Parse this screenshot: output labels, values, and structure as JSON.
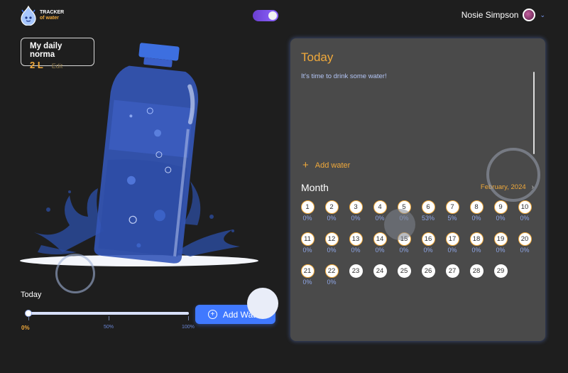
{
  "header": {
    "logo_line1": "TRACKER",
    "logo_line2": "of water",
    "user_name": "Nosie Simpson",
    "theme_toggle_on": true
  },
  "norma": {
    "title": "My daily norma",
    "value": "2 L",
    "edit_label": "Edit"
  },
  "today_progress": {
    "label": "Today",
    "fraction": 0.0,
    "ticks": [
      "0%",
      "50%",
      "100%"
    ]
  },
  "add_water_button": "Add Water",
  "panel": {
    "today_title": "Today",
    "message": "It's time to drink some water!",
    "add_water_link": "Add water",
    "month_title": "Month",
    "month_label": "February, 2024",
    "next_icon": "chevron-right-icon"
  },
  "calendar": [
    {
      "day": "1",
      "pct": "0%"
    },
    {
      "day": "2",
      "pct": "0%"
    },
    {
      "day": "3",
      "pct": "0%"
    },
    {
      "day": "4",
      "pct": "0%"
    },
    {
      "day": "5",
      "pct": "0%"
    },
    {
      "day": "6",
      "pct": "53%"
    },
    {
      "day": "7",
      "pct": "5%"
    },
    {
      "day": "8",
      "pct": "0%"
    },
    {
      "day": "9",
      "pct": "0%"
    },
    {
      "day": "10",
      "pct": "0%"
    },
    {
      "day": "11",
      "pct": "0%"
    },
    {
      "day": "12",
      "pct": "0%"
    },
    {
      "day": "13",
      "pct": "0%"
    },
    {
      "day": "14",
      "pct": "0%"
    },
    {
      "day": "15",
      "pct": "0%"
    },
    {
      "day": "16",
      "pct": "0%"
    },
    {
      "day": "17",
      "pct": "0%"
    },
    {
      "day": "18",
      "pct": "0%"
    },
    {
      "day": "19",
      "pct": "0%"
    },
    {
      "day": "20",
      "pct": "0%"
    },
    {
      "day": "21",
      "pct": "0%"
    },
    {
      "day": "22",
      "pct": "0%"
    },
    {
      "day": "23",
      "pct": ""
    },
    {
      "day": "24",
      "pct": ""
    },
    {
      "day": "25",
      "pct": ""
    },
    {
      "day": "26",
      "pct": ""
    },
    {
      "day": "27",
      "pct": ""
    },
    {
      "day": "28",
      "pct": ""
    },
    {
      "day": "29",
      "pct": ""
    }
  ],
  "colors": {
    "accent_orange": "#f0a93b",
    "accent_blue": "#4079ff",
    "panel_bg": "#4a4a4a",
    "page_bg": "#1e1e1e"
  }
}
